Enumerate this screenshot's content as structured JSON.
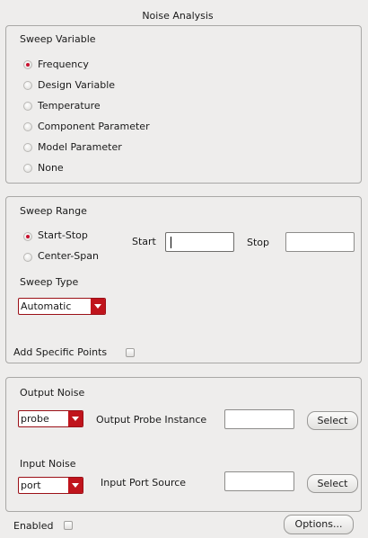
{
  "window": {
    "title": "Noise Analysis"
  },
  "sweep_variable": {
    "header": "Sweep Variable",
    "options": [
      {
        "label": "Frequency",
        "selected": true
      },
      {
        "label": "Design Variable",
        "selected": false
      },
      {
        "label": "Temperature",
        "selected": false
      },
      {
        "label": "Component Parameter",
        "selected": false
      },
      {
        "label": "Model Parameter",
        "selected": false
      },
      {
        "label": "None",
        "selected": false
      }
    ]
  },
  "sweep_range": {
    "header": "Sweep Range",
    "options": [
      {
        "label": "Start-Stop",
        "selected": true
      },
      {
        "label": "Center-Span",
        "selected": false
      }
    ],
    "start_label": "Start",
    "start_value": "",
    "stop_label": "Stop",
    "stop_value": "",
    "sweep_type_label": "Sweep Type",
    "sweep_type_value": "Automatic",
    "add_points_label": "Add Specific Points",
    "add_points_checked": false
  },
  "noise": {
    "output_header": "Output Noise",
    "output_type": "probe",
    "output_instance_label": "Output Probe Instance",
    "output_instance_value": "",
    "output_select": "Select",
    "input_header": "Input Noise",
    "input_type": "port",
    "input_source_label": "Input Port Source",
    "input_source_value": "",
    "input_select": "Select"
  },
  "footer": {
    "enabled_label": "Enabled",
    "enabled_checked": false,
    "options_button": "Options..."
  },
  "colors": {
    "accent": "#c0141c",
    "background": "#eeedec",
    "border": "#a9a8a6"
  }
}
